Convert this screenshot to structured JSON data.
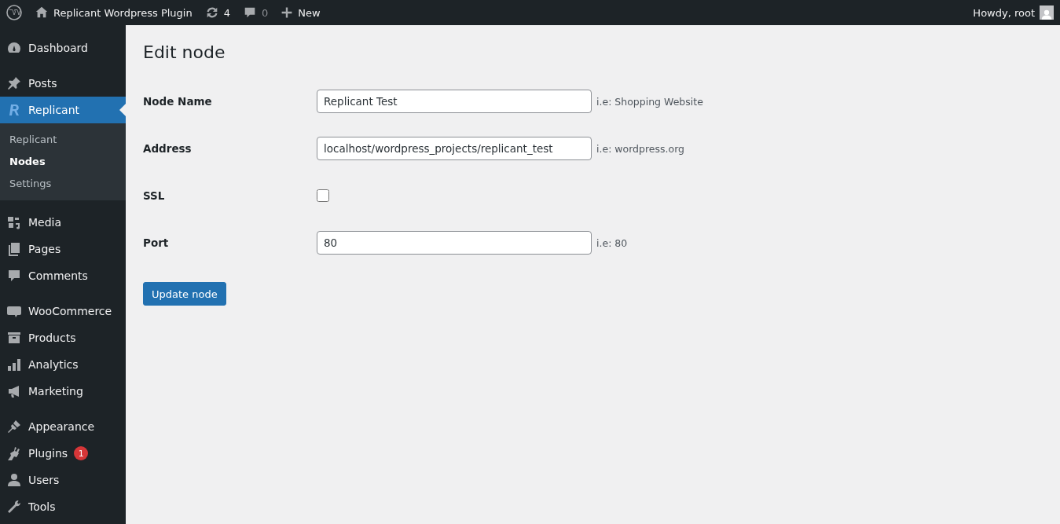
{
  "admin_bar": {
    "site_name": "Replicant Wordpress Plugin",
    "updates": "4",
    "comments": "0",
    "new_label": "New",
    "greeting": "Howdy, root"
  },
  "sidebar": {
    "groups": [
      [
        {
          "label": "Dashboard",
          "selected": false
        }
      ],
      [
        {
          "label": "Posts",
          "selected": false
        },
        {
          "label": "Replicant",
          "selected": true,
          "children": [
            {
              "label": "Replicant",
              "selected": false
            },
            {
              "label": "Nodes",
              "selected": true
            },
            {
              "label": "Settings",
              "selected": false
            }
          ]
        }
      ],
      [
        {
          "label": "Media",
          "selected": false
        },
        {
          "label": "Pages",
          "selected": false
        },
        {
          "label": "Comments",
          "selected": false
        }
      ],
      [
        {
          "label": "WooCommerce",
          "selected": false
        },
        {
          "label": "Products",
          "selected": false
        },
        {
          "label": "Analytics",
          "selected": false
        },
        {
          "label": "Marketing",
          "selected": false
        }
      ],
      [
        {
          "label": "Appearance",
          "selected": false
        },
        {
          "label": "Plugins",
          "selected": false,
          "badge": "1"
        },
        {
          "label": "Users",
          "selected": false
        },
        {
          "label": "Tools",
          "selected": false
        }
      ]
    ]
  },
  "page": {
    "title": "Edit node",
    "fields": [
      {
        "kind": "text",
        "label": "Node Name",
        "value": "Replicant Test",
        "hint": "i.e: Shopping Website"
      },
      {
        "kind": "text",
        "label": "Address",
        "value": "localhost/wordpress_projects/replicant_test",
        "hint": "i.e: wordpress.org"
      },
      {
        "kind": "checkbox",
        "label": "SSL",
        "checked": false
      },
      {
        "kind": "text",
        "label": "Port",
        "value": "80",
        "hint": "i.e: 80"
      }
    ],
    "submit": "Update node"
  }
}
